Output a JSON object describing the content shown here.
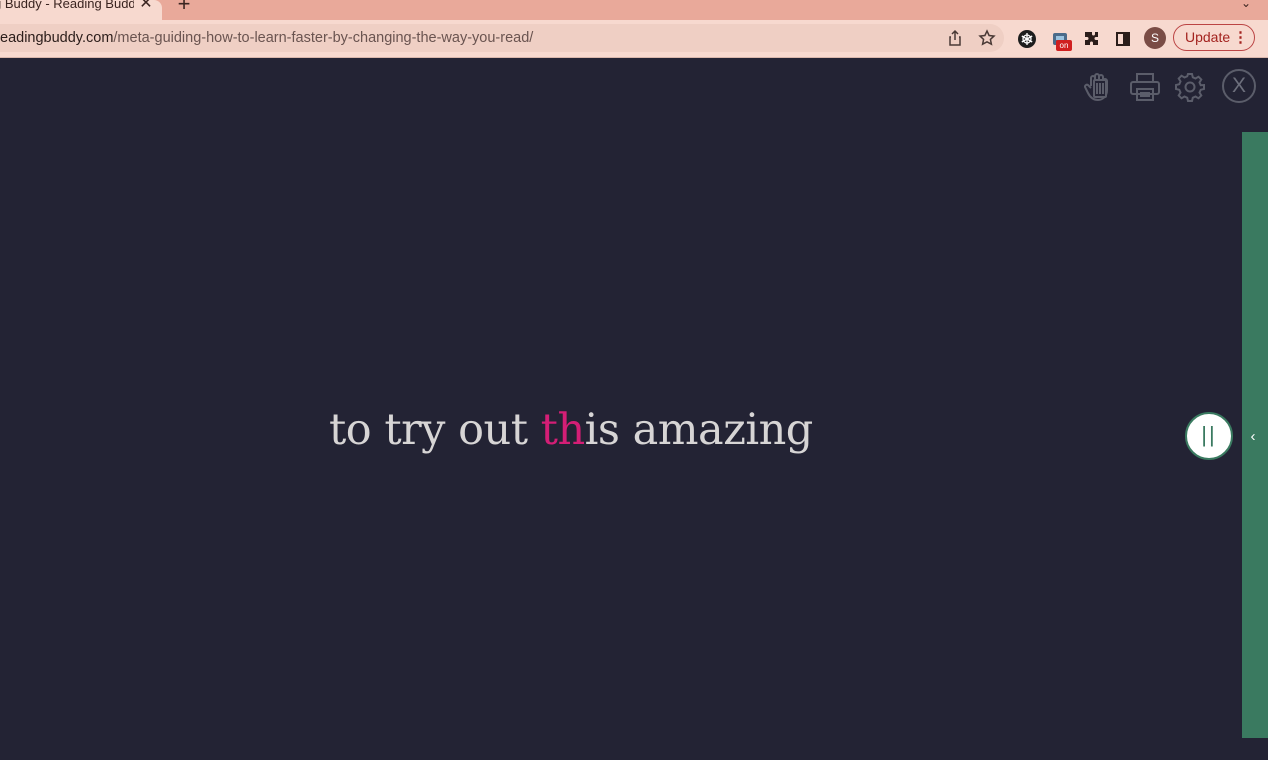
{
  "browser": {
    "tab_title": "g Buddy - Reading Budd",
    "tab_close": "✕",
    "new_tab": "+",
    "tab_search": "⌄",
    "url_domain": "eadingbuddy.com",
    "url_path": "/meta-guiding-how-to-learn-faster-by-changing-the-way-you-read/",
    "ext_badge": "on",
    "profile_initial": "S",
    "update_label": "Update",
    "update_dots": "⋮"
  },
  "reader": {
    "close_label": "X",
    "words_before": "to try out ",
    "highlight": "th",
    "words_after": "is amazing",
    "pause_label": "||",
    "side_chevron": "‹"
  },
  "colors": {
    "background": "#232334",
    "highlight": "#d41e76",
    "side_panel": "#3a7a60",
    "text": "#d7d5d5"
  },
  "icons": [
    "hand-stop-icon",
    "printer-icon",
    "gear-icon",
    "close-icon",
    "share-icon",
    "star-icon",
    "extensions-icon",
    "side-panel-icon"
  ]
}
